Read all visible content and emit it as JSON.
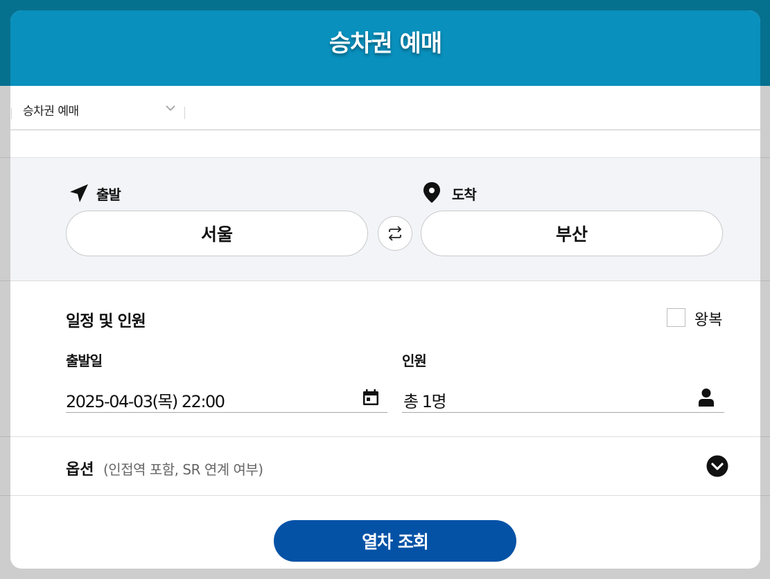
{
  "modal": {
    "title": "승차권 예매"
  },
  "breadcrumb": {
    "selected": "승차권 예매"
  },
  "stations": {
    "departure_label": "출발",
    "departure_value": "서울",
    "arrival_label": "도착",
    "arrival_value": "부산"
  },
  "schedule": {
    "title": "일정 및 인원",
    "roundtrip_label": "왕복",
    "roundtrip_checked": false,
    "date_label": "출발일",
    "date_value": "2025-04-03(목) 22:00",
    "passengers_label": "인원",
    "passengers_value": "총 1명"
  },
  "options": {
    "title": "옵션",
    "subtitle": "(인접역 포함, SR 연계 여부)"
  },
  "submit": {
    "label": "열차 조회"
  },
  "colors": {
    "header_bg": "#0990bd",
    "submit_bg": "#0452a6",
    "station_section_bg": "#f2f4f8"
  },
  "icons": {
    "departure": "navigation-arrow-icon",
    "arrival": "map-pin-icon",
    "swap": "swap-arrows-icon",
    "date": "calendar-icon",
    "passengers": "person-icon",
    "options_toggle": "chevron-down-circle-icon"
  }
}
